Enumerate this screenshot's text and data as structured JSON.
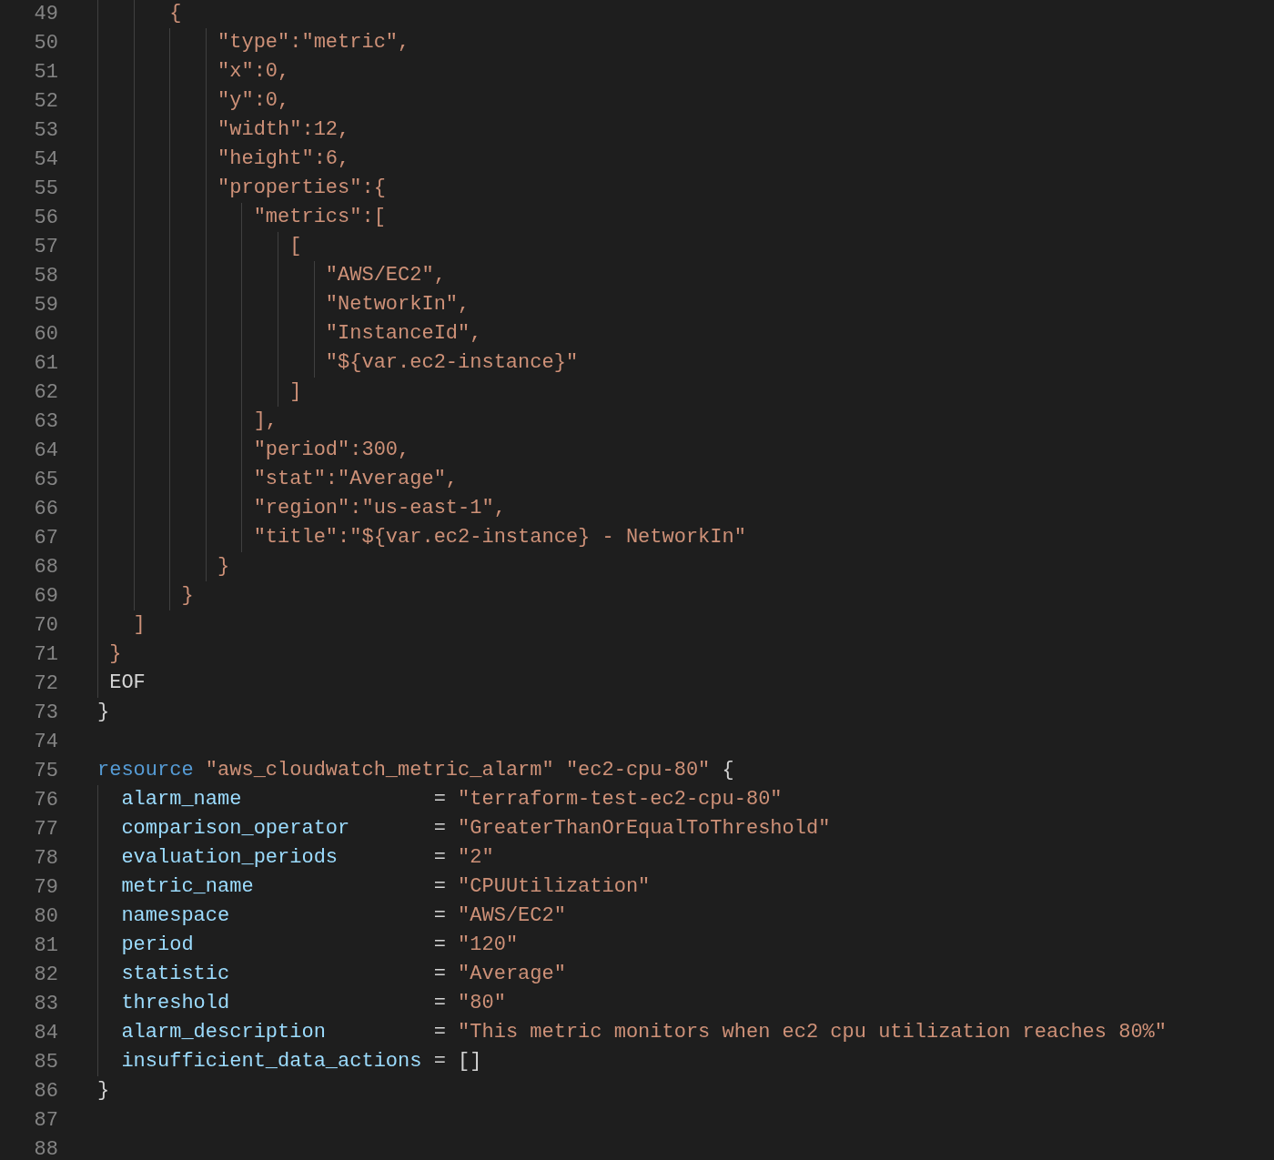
{
  "editor": {
    "lines": [
      {
        "number": "49",
        "tokens": [
          {
            "kind": "string",
            "text": "      {"
          }
        ]
      },
      {
        "number": "50",
        "tokens": [
          {
            "kind": "string",
            "text": "          \"type\":\"metric\","
          }
        ]
      },
      {
        "number": "51",
        "tokens": [
          {
            "kind": "string",
            "text": "          \"x\":0,"
          }
        ]
      },
      {
        "number": "52",
        "tokens": [
          {
            "kind": "string",
            "text": "          \"y\":0,"
          }
        ]
      },
      {
        "number": "53",
        "tokens": [
          {
            "kind": "string",
            "text": "          \"width\":12,"
          }
        ]
      },
      {
        "number": "54",
        "tokens": [
          {
            "kind": "string",
            "text": "          \"height\":6,"
          }
        ]
      },
      {
        "number": "55",
        "tokens": [
          {
            "kind": "string",
            "text": "          \"properties\":{"
          }
        ]
      },
      {
        "number": "56",
        "tokens": [
          {
            "kind": "string",
            "text": "             \"metrics\":["
          }
        ]
      },
      {
        "number": "57",
        "tokens": [
          {
            "kind": "string",
            "text": "                ["
          }
        ]
      },
      {
        "number": "58",
        "tokens": [
          {
            "kind": "string",
            "text": "                   \"AWS/EC2\","
          }
        ]
      },
      {
        "number": "59",
        "tokens": [
          {
            "kind": "string",
            "text": "                   \"NetworkIn\","
          }
        ]
      },
      {
        "number": "60",
        "tokens": [
          {
            "kind": "string",
            "text": "                   \"InstanceId\","
          }
        ]
      },
      {
        "number": "61",
        "tokens": [
          {
            "kind": "string",
            "text": "                   \"${var.ec2-instance}\""
          }
        ]
      },
      {
        "number": "62",
        "tokens": [
          {
            "kind": "string",
            "text": "                ]"
          }
        ]
      },
      {
        "number": "63",
        "tokens": [
          {
            "kind": "string",
            "text": "             ],"
          }
        ]
      },
      {
        "number": "64",
        "tokens": [
          {
            "kind": "string",
            "text": "             \"period\":300,"
          }
        ]
      },
      {
        "number": "65",
        "tokens": [
          {
            "kind": "string",
            "text": "             \"stat\":\"Average\","
          }
        ]
      },
      {
        "number": "66",
        "tokens": [
          {
            "kind": "string",
            "text": "             \"region\":\"us-east-1\","
          }
        ]
      },
      {
        "number": "67",
        "tokens": [
          {
            "kind": "string",
            "text": "             \"title\":\"${var.ec2-instance} - NetworkIn\""
          }
        ]
      },
      {
        "number": "68",
        "tokens": [
          {
            "kind": "string",
            "text": "          }"
          }
        ]
      },
      {
        "number": "69",
        "tokens": [
          {
            "kind": "string",
            "text": "       }"
          }
        ]
      },
      {
        "number": "70",
        "tokens": [
          {
            "kind": "string",
            "text": "   ]"
          }
        ]
      },
      {
        "number": "71",
        "tokens": [
          {
            "kind": "string",
            "text": " }"
          }
        ]
      },
      {
        "number": "72",
        "tokens": [
          {
            "kind": "plain",
            "text": " EOF"
          }
        ]
      },
      {
        "number": "73",
        "tokens": [
          {
            "kind": "plain",
            "text": "}"
          }
        ]
      },
      {
        "number": "74"
      },
      {
        "number": "75",
        "tokens": [
          {
            "kind": "keyword",
            "text": "resource"
          },
          {
            "kind": "string",
            "text": " \"aws_cloudwatch_metric_alarm\" \"ec2-cpu-80\""
          },
          {
            "kind": "plain",
            "text": " {"
          }
        ]
      },
      {
        "number": "76",
        "tokens": [
          {
            "kind": "attribute",
            "text": "  alarm_name"
          },
          {
            "kind": "plain",
            "text": "                = "
          },
          {
            "kind": "string",
            "text": "\"terraform-test-ec2-cpu-80\""
          }
        ]
      },
      {
        "number": "77",
        "tokens": [
          {
            "kind": "attribute",
            "text": "  comparison_operator"
          },
          {
            "kind": "plain",
            "text": "       = "
          },
          {
            "kind": "string",
            "text": "\"GreaterThanOrEqualToThreshold\""
          }
        ]
      },
      {
        "number": "78",
        "tokens": [
          {
            "kind": "attribute",
            "text": "  evaluation_periods"
          },
          {
            "kind": "plain",
            "text": "        = "
          },
          {
            "kind": "string",
            "text": "\"2\""
          }
        ]
      },
      {
        "number": "79",
        "tokens": [
          {
            "kind": "attribute",
            "text": "  metric_name"
          },
          {
            "kind": "plain",
            "text": "               = "
          },
          {
            "kind": "string",
            "text": "\"CPUUtilization\""
          }
        ]
      },
      {
        "number": "80",
        "tokens": [
          {
            "kind": "attribute",
            "text": "  namespace"
          },
          {
            "kind": "plain",
            "text": "                 = "
          },
          {
            "kind": "string",
            "text": "\"AWS/EC2\""
          }
        ]
      },
      {
        "number": "81",
        "tokens": [
          {
            "kind": "attribute",
            "text": "  period"
          },
          {
            "kind": "plain",
            "text": "                    = "
          },
          {
            "kind": "string",
            "text": "\"120\""
          }
        ]
      },
      {
        "number": "82",
        "tokens": [
          {
            "kind": "attribute",
            "text": "  statistic"
          },
          {
            "kind": "plain",
            "text": "                 = "
          },
          {
            "kind": "string",
            "text": "\"Average\""
          }
        ]
      },
      {
        "number": "83",
        "tokens": [
          {
            "kind": "attribute",
            "text": "  threshold"
          },
          {
            "kind": "plain",
            "text": "                 = "
          },
          {
            "kind": "string",
            "text": "\"80\""
          }
        ]
      },
      {
        "number": "84",
        "tokens": [
          {
            "kind": "attribute",
            "text": "  alarm_description"
          },
          {
            "kind": "plain",
            "text": "         = "
          },
          {
            "kind": "string",
            "text": "\"This metric monitors when ec2 cpu utilization reaches 80%\""
          }
        ]
      },
      {
        "number": "85",
        "tokens": [
          {
            "kind": "attribute",
            "text": "  insufficient_data_actions"
          },
          {
            "kind": "plain",
            "text": " = []"
          }
        ]
      },
      {
        "number": "86",
        "tokens": [
          {
            "kind": "plain",
            "text": "}"
          }
        ]
      },
      {
        "number": "87"
      },
      {
        "number": "88"
      }
    ]
  }
}
